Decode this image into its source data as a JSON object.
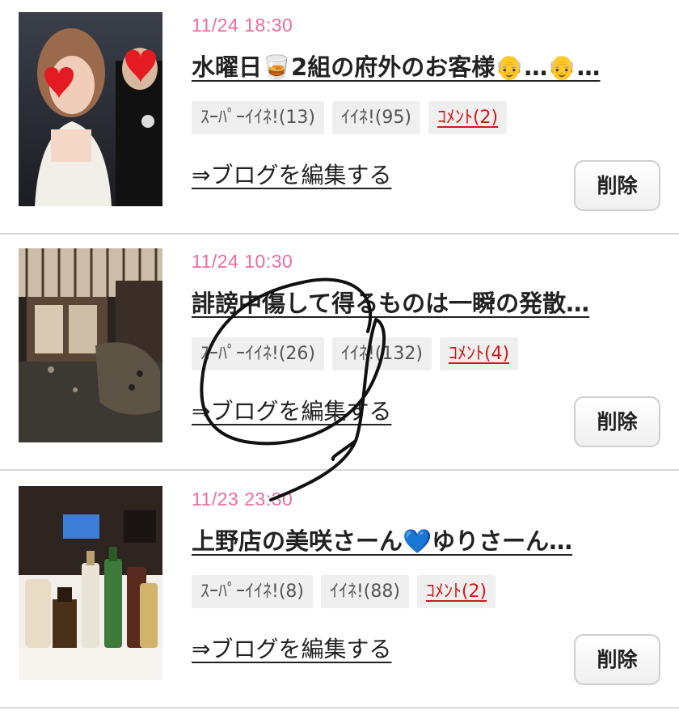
{
  "posts": [
    {
      "date": "11/24 18:30",
      "title": "水曜日🥃2組の府外のお客様👴…👴…",
      "super_like": "ｽｰﾊﾟｰｲｲﾈ!(13)",
      "like": "ｲｲﾈ!(95)",
      "comment": "ｺﾒﾝﾄ(2)",
      "edit": "⇒ブログを編集する",
      "delete": "削除",
      "thumb_icon": "portrait-photo-icon"
    },
    {
      "date": "11/24 10:30",
      "title": "誹謗中傷して得るものは一瞬の発散…",
      "super_like": "ｽｰﾊﾟｰｲｲﾈ!(26)",
      "like": "ｲｲﾈ!(132)",
      "comment": "ｺﾒﾝﾄ(4)",
      "edit": "⇒ブログを編集する",
      "delete": "削除",
      "thumb_icon": "storefront-photo-icon"
    },
    {
      "date": "11/23 23:30",
      "title": "上野店の美咲さーん💙ゆりさーん…",
      "super_like": "ｽｰﾊﾟｰｲｲﾈ!(8)",
      "like": "ｲｲﾈ!(88)",
      "comment": "ｺﾒﾝﾄ(2)",
      "edit": "⇒ブログを編集する",
      "delete": "削除",
      "thumb_icon": "bottles-photo-icon"
    }
  ],
  "colors": {
    "date": "#ef6aa0",
    "comment": "#d01818",
    "badge_bg": "#efefef",
    "divider": "#d8d8d8"
  }
}
